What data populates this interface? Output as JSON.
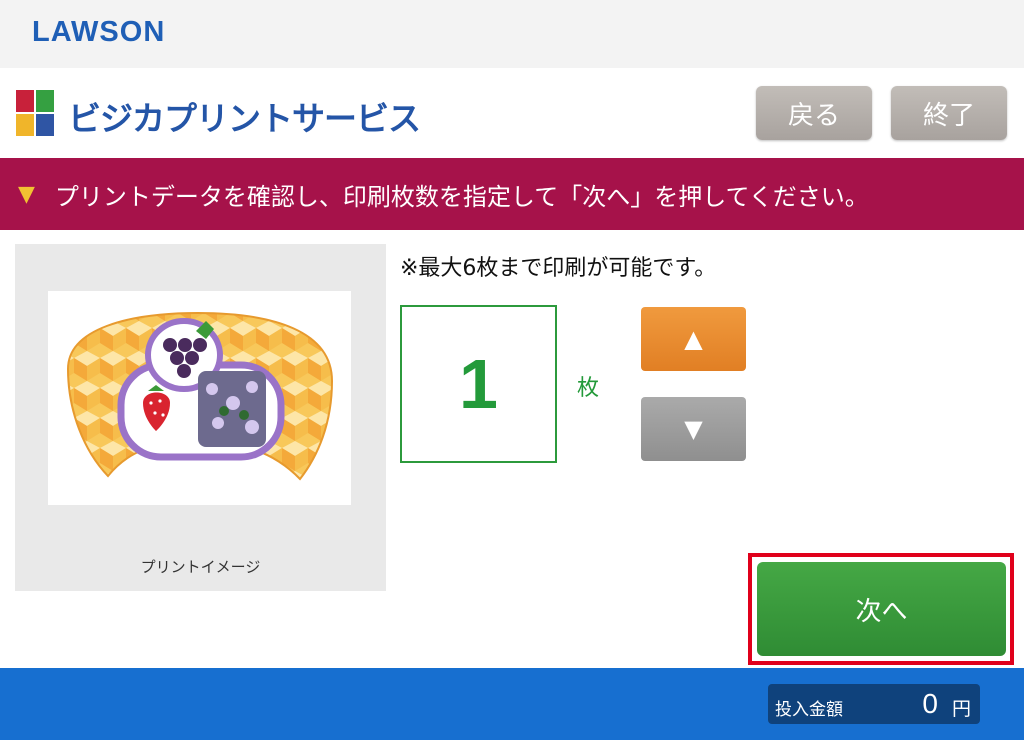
{
  "header": {
    "brand": "LAWSON",
    "service_title": "ビジカプリントサービス",
    "back_label": "戻る",
    "end_label": "終了"
  },
  "instruction": {
    "text": "プリントデータを確認し、印刷枚数を指定して「次へ」を押してください。"
  },
  "preview": {
    "caption": "プリントイメージ"
  },
  "quantity": {
    "notice": "※最大6枚まで印刷が可能です。",
    "value": "1",
    "unit": "枚",
    "max": 6
  },
  "controls": {
    "increase_symbol": "▲",
    "decrease_symbol": "▼",
    "next_label": "次へ"
  },
  "payment": {
    "label": "投入金額",
    "amount": "0",
    "unit": "円"
  },
  "colors": {
    "accent": "#a6124a",
    "brand_blue": "#176fd0",
    "count_green": "#239a3a",
    "highlight": "#e0001b"
  }
}
